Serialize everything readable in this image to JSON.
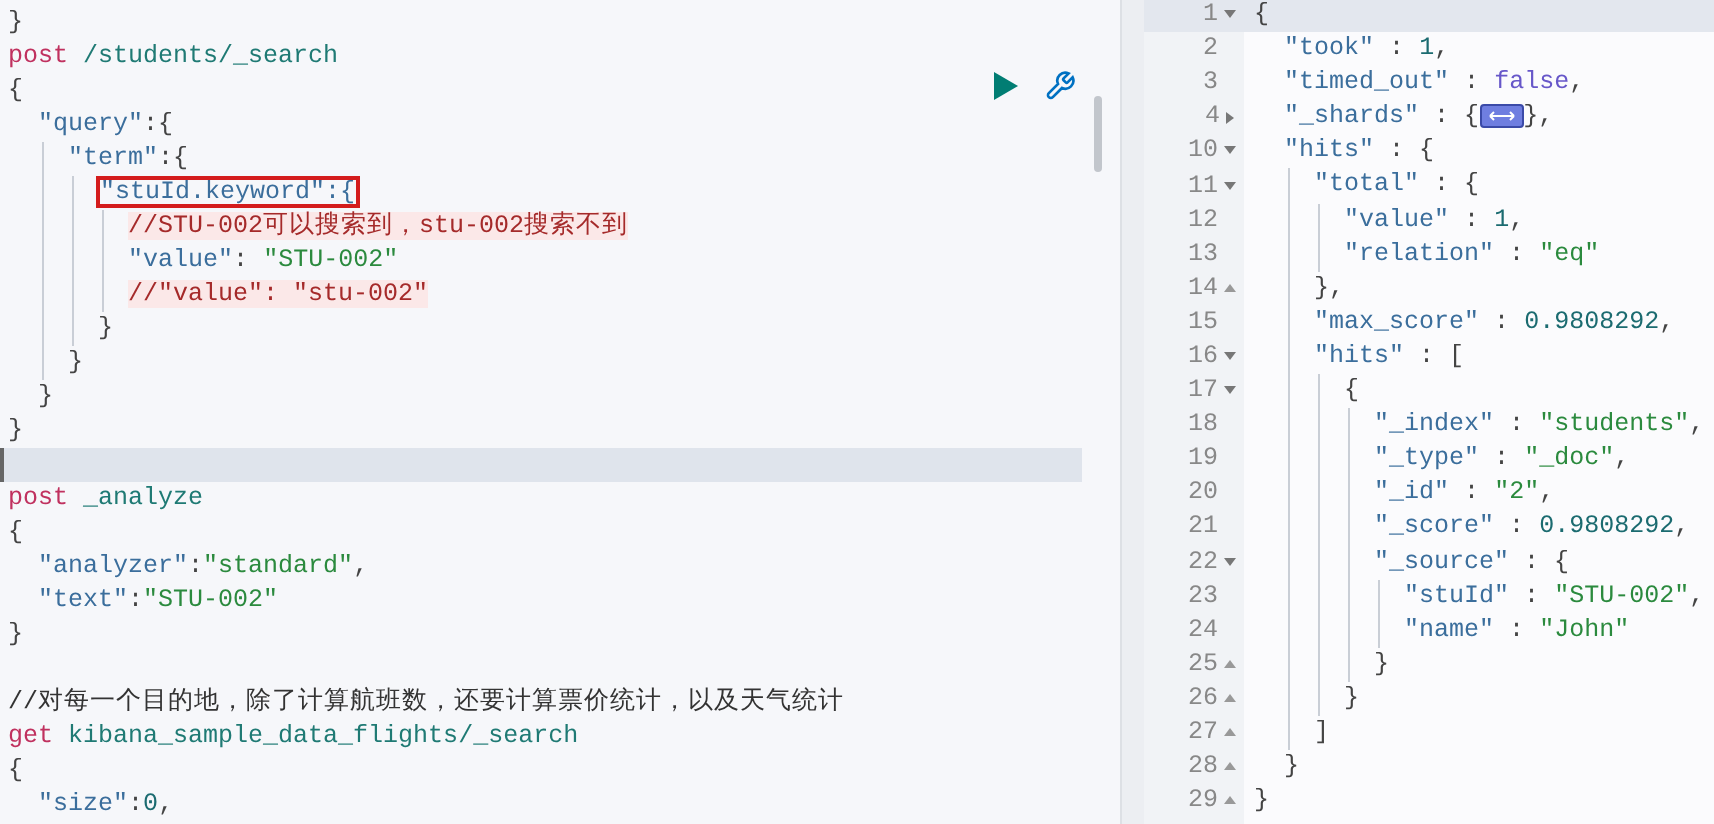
{
  "request_editor": {
    "lines": [
      {
        "active": false,
        "tokens": [
          {
            "kind": "punct",
            "text": "}"
          }
        ]
      },
      {
        "active": false,
        "tokens": [
          {
            "kind": "method",
            "text": "post"
          },
          {
            "kind": "path",
            "text": " /students/_search"
          }
        ]
      },
      {
        "active": false,
        "tokens": [
          {
            "kind": "punct",
            "text": "{"
          }
        ]
      },
      {
        "active": false,
        "tokens": [
          {
            "kind": "key",
            "text": "  \"query\""
          },
          {
            "kind": "punct",
            "text": ":{"
          }
        ]
      },
      {
        "active": false,
        "tokens": [
          {
            "kind": "key",
            "text": "    \"term\""
          },
          {
            "kind": "punct",
            "text": ":{"
          }
        ]
      },
      {
        "active": false,
        "tokens": [
          {
            "kind": "boxed_key",
            "text": "      \"stuId.keyword\":{"
          }
        ]
      },
      {
        "active": false,
        "tokens": [
          {
            "kind": "body_comment",
            "text": "        //STU-002可以搜索到，stu-002搜索不到"
          }
        ]
      },
      {
        "active": false,
        "tokens": [
          {
            "kind": "key",
            "text": "        \"value\""
          },
          {
            "kind": "punct",
            "text": ":"
          },
          {
            "kind": "string",
            "text": " \"STU-002\""
          }
        ]
      },
      {
        "active": false,
        "tokens": [
          {
            "kind": "body_comment",
            "text": "        //\"value\": \"stu-002\""
          }
        ]
      },
      {
        "active": false,
        "tokens": [
          {
            "kind": "punct",
            "text": "      }"
          }
        ]
      },
      {
        "active": false,
        "tokens": [
          {
            "kind": "punct",
            "text": "    }"
          }
        ]
      },
      {
        "active": false,
        "tokens": [
          {
            "kind": "punct",
            "text": "  }"
          }
        ]
      },
      {
        "active": false,
        "tokens": [
          {
            "kind": "punct",
            "text": "}"
          }
        ]
      },
      {
        "active": true
      },
      {
        "active": false,
        "tokens": [
          {
            "kind": "method",
            "text": "post"
          },
          {
            "kind": "path",
            "text": " _analyze"
          }
        ]
      },
      {
        "active": false,
        "tokens": [
          {
            "kind": "punct",
            "text": "{"
          }
        ]
      },
      {
        "active": false,
        "tokens": [
          {
            "kind": "key",
            "text": "  \"analyzer\""
          },
          {
            "kind": "punct",
            "text": ":"
          },
          {
            "kind": "string",
            "text": "\"standard\""
          },
          {
            "kind": "punct",
            "text": ","
          }
        ]
      },
      {
        "active": false,
        "tokens": [
          {
            "kind": "key",
            "text": "  \"text\""
          },
          {
            "kind": "punct",
            "text": ":"
          },
          {
            "kind": "string",
            "text": "\"STU-002\""
          }
        ]
      },
      {
        "active": false,
        "tokens": [
          {
            "kind": "punct",
            "text": "}"
          }
        ]
      },
      {
        "active": false
      },
      {
        "active": false,
        "tokens": [
          {
            "kind": "comment",
            "text": "//对每一个目的地，除了计算航班数，还要计算票价统计，以及天气统计"
          }
        ]
      },
      {
        "active": false,
        "tokens": [
          {
            "kind": "method",
            "text": "get"
          },
          {
            "kind": "path",
            "text": " kibana_sample_data_flights/_search"
          }
        ]
      },
      {
        "active": false,
        "tokens": [
          {
            "kind": "punct",
            "text": "{"
          }
        ]
      },
      {
        "active": false,
        "tokens": [
          {
            "kind": "key",
            "text": "  \"size\""
          },
          {
            "kind": "punct",
            "text": ":"
          },
          {
            "kind": "number",
            "text": "0"
          },
          {
            "kind": "punct",
            "text": ","
          }
        ]
      }
    ]
  },
  "response_viewer": {
    "lines": [
      {
        "number": "1",
        "kind": "open",
        "active": true,
        "tokens": [
          {
            "kind": "punct",
            "text": "{"
          }
        ]
      },
      {
        "number": "2",
        "kind": "plain",
        "active": false,
        "tokens": [
          {
            "kind": "key",
            "text": "  \"took\""
          },
          {
            "kind": "punct",
            "text": " :"
          },
          {
            "kind": "number",
            "text": " 1"
          },
          {
            "kind": "punct",
            "text": ","
          }
        ]
      },
      {
        "number": "3",
        "kind": "plain",
        "active": false,
        "tokens": [
          {
            "kind": "key",
            "text": "  \"timed_out\""
          },
          {
            "kind": "punct",
            "text": " :"
          },
          {
            "kind": "boolean",
            "text": " false"
          },
          {
            "kind": "punct",
            "text": ","
          }
        ]
      },
      {
        "number": "4",
        "kind": "closed",
        "active": false,
        "tokens": [
          {
            "kind": "key",
            "text": "  \"_shards\""
          },
          {
            "kind": "punct",
            "text": " : {"
          },
          {
            "kind": "fold_marker"
          },
          {
            "kind": "punct",
            "text": "},"
          }
        ]
      },
      {
        "number": "10",
        "kind": "open",
        "active": false,
        "tokens": [
          {
            "kind": "key",
            "text": "  \"hits\""
          },
          {
            "kind": "punct",
            "text": " : {"
          }
        ]
      },
      {
        "number": "11",
        "kind": "open",
        "active": false,
        "tokens": [
          {
            "kind": "key",
            "text": "    \"total\""
          },
          {
            "kind": "punct",
            "text": " : {"
          }
        ]
      },
      {
        "number": "12",
        "kind": "plain",
        "active": false,
        "tokens": [
          {
            "kind": "key",
            "text": "      \"value\""
          },
          {
            "kind": "punct",
            "text": " :"
          },
          {
            "kind": "number",
            "text": " 1"
          },
          {
            "kind": "punct",
            "text": ","
          }
        ]
      },
      {
        "number": "13",
        "kind": "plain",
        "active": false,
        "tokens": [
          {
            "kind": "key",
            "text": "      \"relation\""
          },
          {
            "kind": "punct",
            "text": " :"
          },
          {
            "kind": "string",
            "text": " \"eq\""
          }
        ]
      },
      {
        "number": "14",
        "kind": "end",
        "active": false,
        "tokens": [
          {
            "kind": "punct",
            "text": "    },"
          }
        ]
      },
      {
        "number": "15",
        "kind": "plain",
        "active": false,
        "tokens": [
          {
            "kind": "key",
            "text": "    \"max_score\""
          },
          {
            "kind": "punct",
            "text": " :"
          },
          {
            "kind": "number",
            "text": " 0.9808292"
          },
          {
            "kind": "punct",
            "text": ","
          }
        ]
      },
      {
        "number": "16",
        "kind": "open",
        "active": false,
        "tokens": [
          {
            "kind": "key",
            "text": "    \"hits\""
          },
          {
            "kind": "punct",
            "text": " : ["
          }
        ]
      },
      {
        "number": "17",
        "kind": "open",
        "active": false,
        "tokens": [
          {
            "kind": "punct",
            "text": "      {"
          }
        ]
      },
      {
        "number": "18",
        "kind": "plain",
        "active": false,
        "tokens": [
          {
            "kind": "key",
            "text": "        \"_index\""
          },
          {
            "kind": "punct",
            "text": " :"
          },
          {
            "kind": "string",
            "text": " \"students\""
          },
          {
            "kind": "punct",
            "text": ","
          }
        ]
      },
      {
        "number": "19",
        "kind": "plain",
        "active": false,
        "tokens": [
          {
            "kind": "key",
            "text": "        \"_type\""
          },
          {
            "kind": "punct",
            "text": " :"
          },
          {
            "kind": "string",
            "text": " \"_doc\""
          },
          {
            "kind": "punct",
            "text": ","
          }
        ]
      },
      {
        "number": "20",
        "kind": "plain",
        "active": false,
        "tokens": [
          {
            "kind": "key",
            "text": "        \"_id\""
          },
          {
            "kind": "punct",
            "text": " :"
          },
          {
            "kind": "string",
            "text": " \"2\""
          },
          {
            "kind": "punct",
            "text": ","
          }
        ]
      },
      {
        "number": "21",
        "kind": "plain",
        "active": false,
        "tokens": [
          {
            "kind": "key",
            "text": "        \"_score\""
          },
          {
            "kind": "punct",
            "text": " :"
          },
          {
            "kind": "number",
            "text": " 0.9808292"
          },
          {
            "kind": "punct",
            "text": ","
          }
        ]
      },
      {
        "number": "22",
        "kind": "open",
        "active": false,
        "tokens": [
          {
            "kind": "key",
            "text": "        \"_source\""
          },
          {
            "kind": "punct",
            "text": " : {"
          }
        ]
      },
      {
        "number": "23",
        "kind": "plain",
        "active": false,
        "tokens": [
          {
            "kind": "key",
            "text": "          \"stuId\""
          },
          {
            "kind": "punct",
            "text": " :"
          },
          {
            "kind": "string",
            "text": " \"STU-002\""
          },
          {
            "kind": "punct",
            "text": ","
          }
        ]
      },
      {
        "number": "24",
        "kind": "plain",
        "active": false,
        "tokens": [
          {
            "kind": "key",
            "text": "          \"name\""
          },
          {
            "kind": "punct",
            "text": " :"
          },
          {
            "kind": "string",
            "text": " \"John\""
          }
        ]
      },
      {
        "number": "25",
        "kind": "end",
        "active": false,
        "tokens": [
          {
            "kind": "punct",
            "text": "        }"
          }
        ]
      },
      {
        "number": "26",
        "kind": "end",
        "active": false,
        "tokens": [
          {
            "kind": "punct",
            "text": "      }"
          }
        ]
      },
      {
        "number": "27",
        "kind": "end",
        "active": false,
        "tokens": [
          {
            "kind": "punct",
            "text": "    ]"
          }
        ]
      },
      {
        "number": "28",
        "kind": "end",
        "active": false,
        "tokens": [
          {
            "kind": "punct",
            "text": "  }"
          }
        ]
      },
      {
        "number": "29",
        "kind": "end",
        "active": false,
        "tokens": [
          {
            "kind": "punct",
            "text": "}"
          }
        ]
      }
    ]
  }
}
